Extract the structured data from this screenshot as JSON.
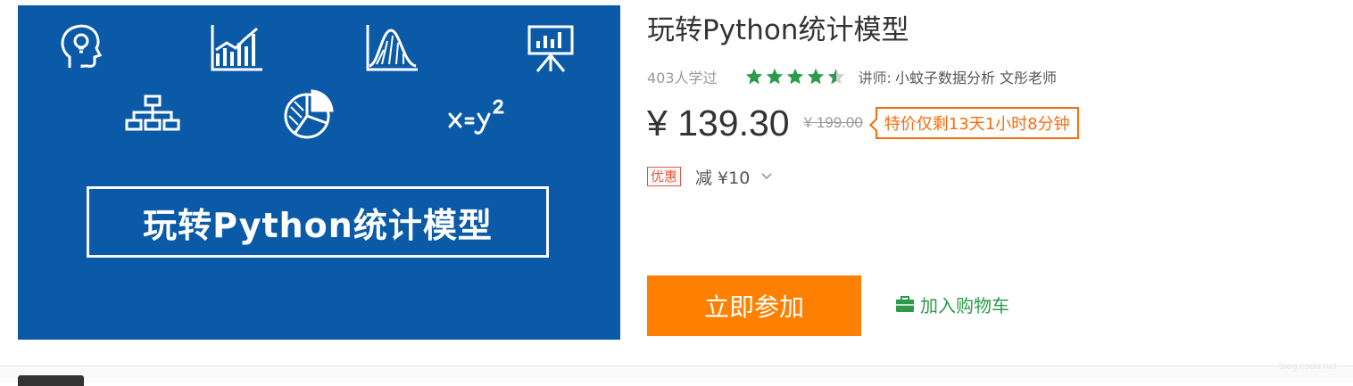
{
  "course": {
    "cover_title": "玩转Python统计模型",
    "title": "玩转Python统计模型",
    "learners": "403人学过",
    "rating": 4.5,
    "teacher_label": "讲师:",
    "teacher_name": "小蚊子数据分析 文彤老师"
  },
  "pricing": {
    "price": "¥ 139.30",
    "original_price": "¥ 199.00",
    "countdown": "特价仅剩13天1小时8分钟"
  },
  "promo": {
    "badge": "优惠",
    "text": "减 ¥10"
  },
  "actions": {
    "join_label": "立即参加",
    "cart_label": "加入购物车"
  },
  "colors": {
    "cover_bg": "#0b5aa8",
    "accent_orange": "#ff8000",
    "star_green": "#2c9b4a",
    "cart_green": "#2c9b4a"
  },
  "icons": [
    "head-bulb-icon",
    "bar-chart-icon",
    "distribution-icon",
    "presentation-icon",
    "hierarchy-icon",
    "pie-chart-icon",
    "formula-icon",
    "star-icon",
    "chevron-down-icon",
    "cart-icon"
  ],
  "watermark": "blog.csdn.net"
}
